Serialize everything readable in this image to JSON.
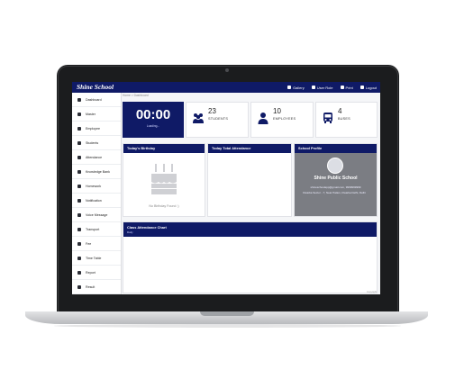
{
  "app": {
    "brand": "Shine School"
  },
  "topnav": [
    {
      "label": "Gallery",
      "icon": "image-icon"
    },
    {
      "label": "User Role",
      "icon": "user-icon"
    },
    {
      "label": "Print",
      "icon": "printer-icon"
    },
    {
      "label": "Logout",
      "icon": "logout-icon"
    }
  ],
  "breadcrumb": {
    "home": "Home",
    "sep": ">",
    "current": "Dashboard"
  },
  "sidebar": {
    "items": [
      {
        "label": "Dashboard",
        "icon": "monitor-icon"
      },
      {
        "label": "Master",
        "icon": "wrench-icon"
      },
      {
        "label": "Employee",
        "icon": "user-icon"
      },
      {
        "label": "Students",
        "icon": "graduation-cap-icon"
      },
      {
        "label": "Attendance",
        "icon": "check-icon"
      },
      {
        "label": "Knowledge Bank",
        "icon": "book-icon"
      },
      {
        "label": "Homework",
        "icon": "pencil-icon"
      },
      {
        "label": "Notification",
        "icon": "bell-icon"
      },
      {
        "label": "Voice Message",
        "icon": "microphone-icon"
      },
      {
        "label": "Transport",
        "icon": "bus-icon"
      },
      {
        "label": "Fee",
        "icon": "money-icon"
      },
      {
        "label": "Time Table",
        "icon": "clock-icon"
      },
      {
        "label": "Report",
        "icon": "print-icon"
      },
      {
        "label": "Result",
        "icon": "pencil-icon"
      }
    ]
  },
  "stats": {
    "clock": {
      "time": "00:00",
      "status": "Loading..."
    },
    "students": {
      "value": "23",
      "label": "STUDENTS",
      "icon": "users-icon"
    },
    "employees": {
      "value": "10",
      "label": "EMPLOYEES",
      "icon": "user-icon"
    },
    "buses": {
      "value": "4",
      "label": "BUSES",
      "icon": "bus-icon"
    }
  },
  "panels": {
    "birthday": {
      "title": "Today's Birthday",
      "empty": "No Birthday Found :)",
      "icon": "cake-icon"
    },
    "attendance": {
      "title": "Today Total Attendance"
    },
    "profile": {
      "title": "School Profile",
      "name": "Shine Public School",
      "email": "shineschoolapp@gmail.com, 9999999999",
      "address": "Dwarka Sector - 7, Near Palam, Dwarka Delhi, Delhi"
    }
  },
  "chart": {
    "title": "Class Attendance Chart",
    "subtitle": "Daily"
  },
  "footer": "Copyright",
  "colors": {
    "primary": "#0f1a66",
    "background": "#f5f6f8"
  }
}
